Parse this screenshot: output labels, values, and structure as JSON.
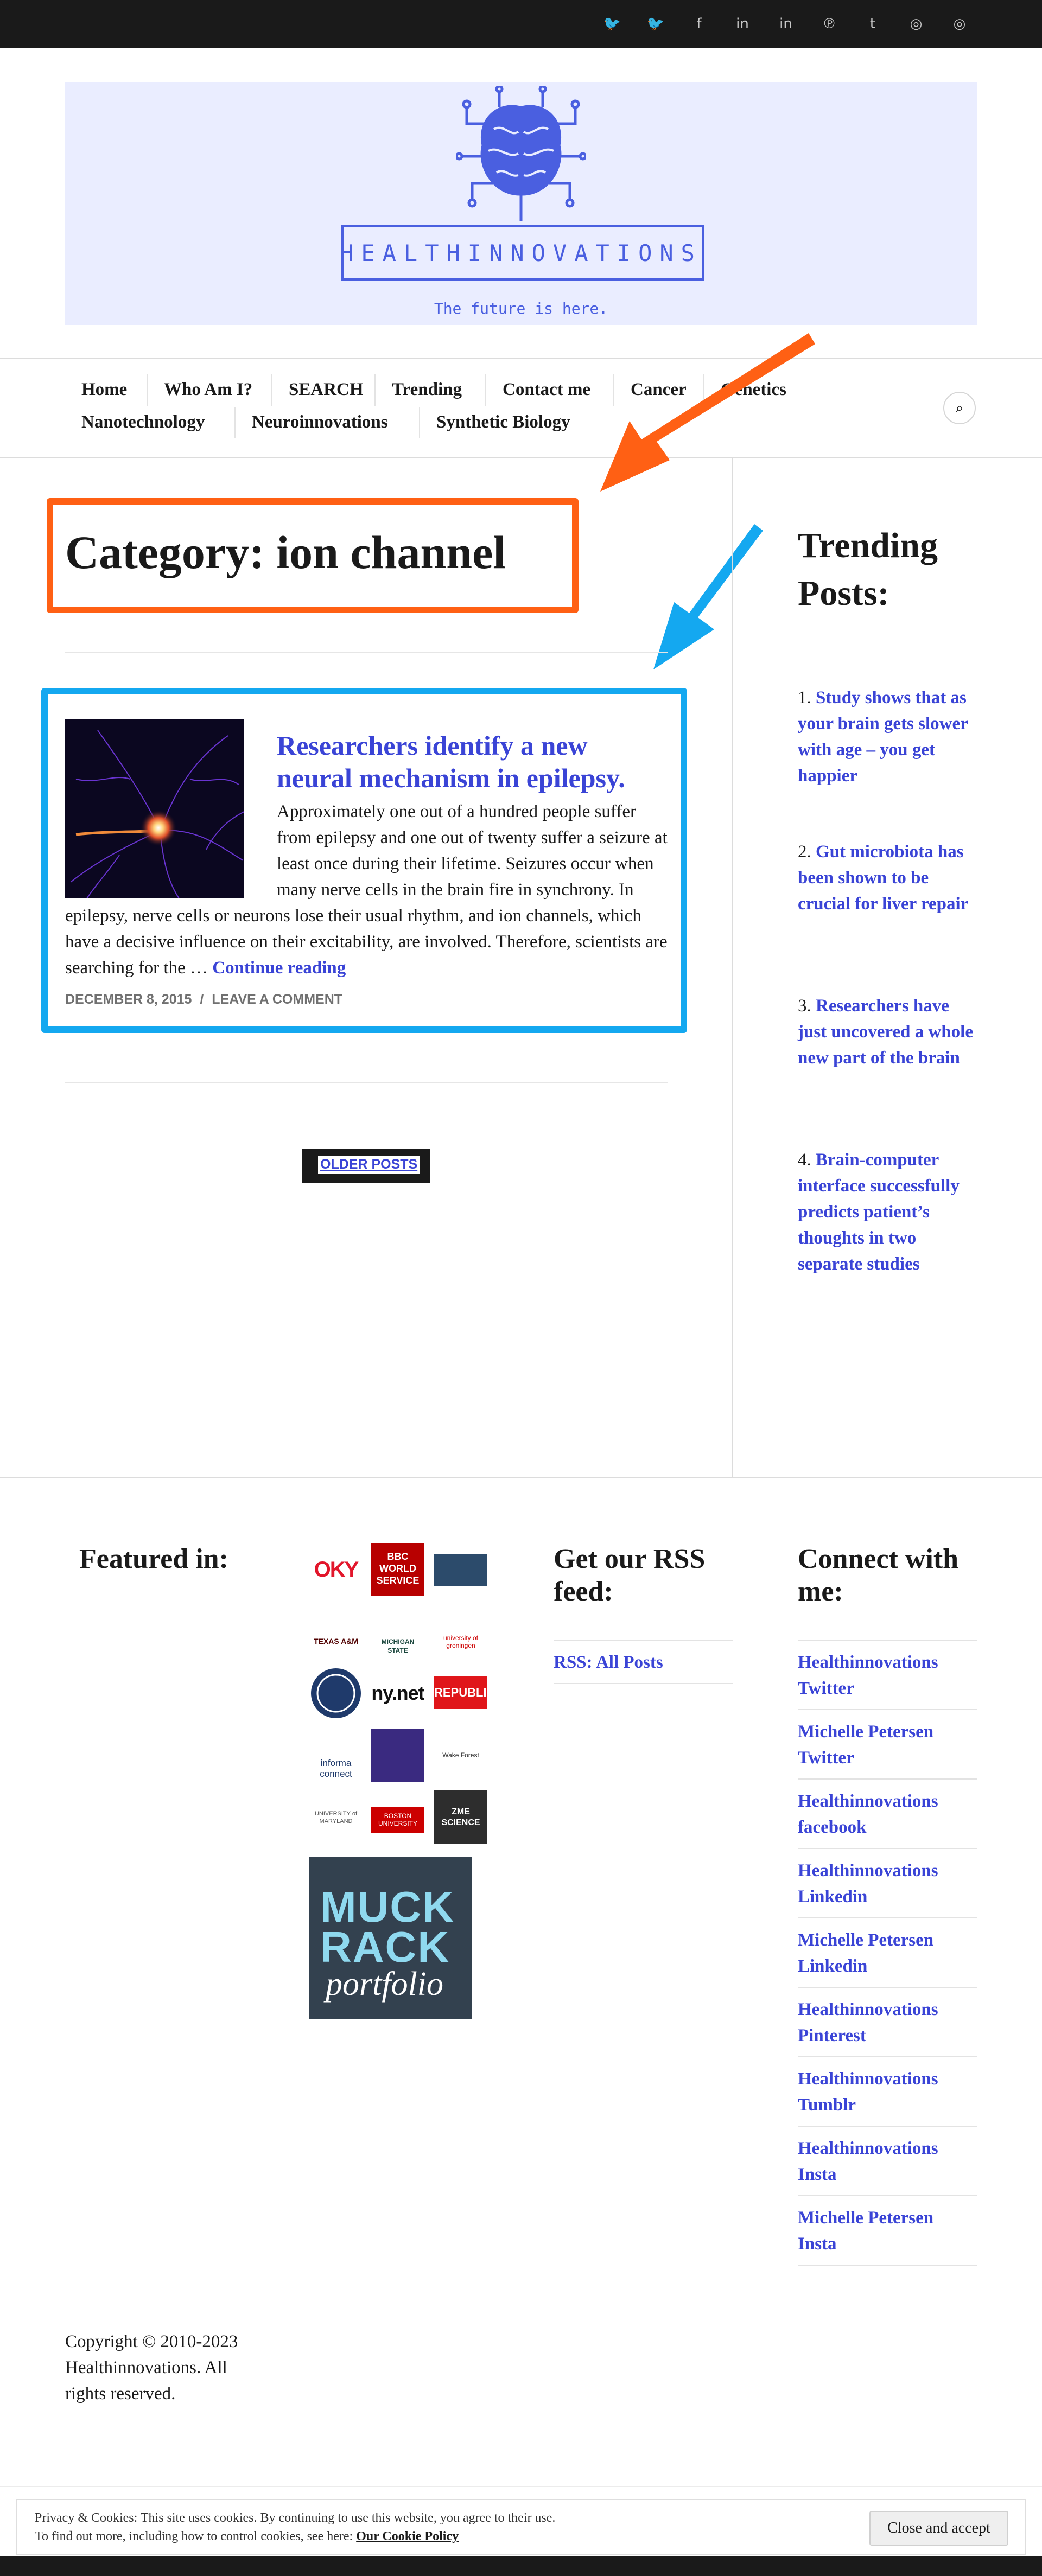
{
  "social_icons": [
    "twitter-icon",
    "twitter-icon",
    "facebook-icon",
    "linkedin-icon",
    "linkedin-icon",
    "pinterest-icon",
    "tumblr-icon",
    "instagram-icon",
    "instagram-icon"
  ],
  "social_glyphs": [
    "🐦",
    "🐦",
    "f",
    "in",
    "in",
    "℗",
    "t",
    "◎",
    "◎"
  ],
  "header": {
    "site_title": "HEALTHINNOVATIONS",
    "tagline": "The future is here.",
    "brand_color": "#4a5fe0"
  },
  "nav": {
    "items": [
      "Home",
      "Who Am I?",
      "SEARCH",
      "Trending",
      "Contact me",
      "Cancer",
      "Genetics",
      "Nanotechnology",
      "Neuroinnovations",
      "Synthetic Biology"
    ],
    "search_icon": "search-icon"
  },
  "main": {
    "page_title": "Category: ion channel",
    "post": {
      "title": "Researchers identify a new neural mechanism in epilepsy.",
      "excerpt_1": "Approximately one out of a hundred people suffer from epilepsy and one out of twenty suffer a seizure at least once during their lifetime. Seizures occur when many nerve cells in the brain fire in synchrony.  In epilepsy, nerve cells or neurons lose their usual rhythm, and ion channels, which have a decisive influence on their excitability, are involved. Therefore, scientists are searching for the … ",
      "continue_label": "Continue reading",
      "date": "DECEMBER 8, 2015",
      "meta_sep": "/",
      "comment_label": "LEAVE A COMMENT"
    },
    "older_posts_label": "OLDER POSTS"
  },
  "sidebar": {
    "title": "Trending Posts:",
    "items": [
      {
        "num": "1.",
        "label": "Study shows that as your brain gets slower with age – you get happier"
      },
      {
        "num": "2.",
        "label": "Gut microbiota has been shown to be crucial for liver repair"
      },
      {
        "num": "3.",
        "label": "Researchers have just uncovered a whole new part of the brain"
      },
      {
        "num": "4.",
        "label": "Brain-computer interface successfully predicts patient’s thoughts in two separate studies"
      }
    ]
  },
  "footer": {
    "featured_title": "Featured in:",
    "featured_logos": [
      "OKY",
      "BBC WORLD SERVICE",
      "",
      "TEXAS A&M",
      "MICHIGAN STATE",
      "university of groningen",
      "",
      "ny.net",
      "REPUBLIC",
      "informa connect",
      "",
      "Wake Forest",
      "UNIVERSITY of MARYLAND",
      "BOSTON UNIVERSITY",
      "ZME SCIENCE"
    ],
    "muckrack_top": "MUCK RACK",
    "muckrack_bottom": "portfolio",
    "rss_title": "Get our RSS feed:",
    "rss_link": "RSS: All Posts",
    "connect_title": "Connect with me:",
    "connect_links": [
      "Healthinnovations Twitter",
      "Michelle Petersen Twitter",
      "Healthinnovations facebook",
      "Healthinnovations Linkedin",
      "Michelle Petersen Linkedin",
      "Healthinnovations Pinterest",
      "Healthinnovations Tumblr",
      "Healthinnovations Insta",
      "Michelle Petersen Insta"
    ],
    "copyright": "Copyright © 2010-2023 Healthinnovations. All rights reserved."
  },
  "cookie": {
    "line1": "Privacy & Cookies: This site uses cookies. By continuing to use this website, you agree to their use.",
    "line2": "To find out more, including how to control cookies, see here: ",
    "policy_link": "Our Cookie Policy",
    "button_label": "Close and accept"
  },
  "annotation_colors": {
    "orange": "#ff6014",
    "blue": "#14a8f0"
  }
}
